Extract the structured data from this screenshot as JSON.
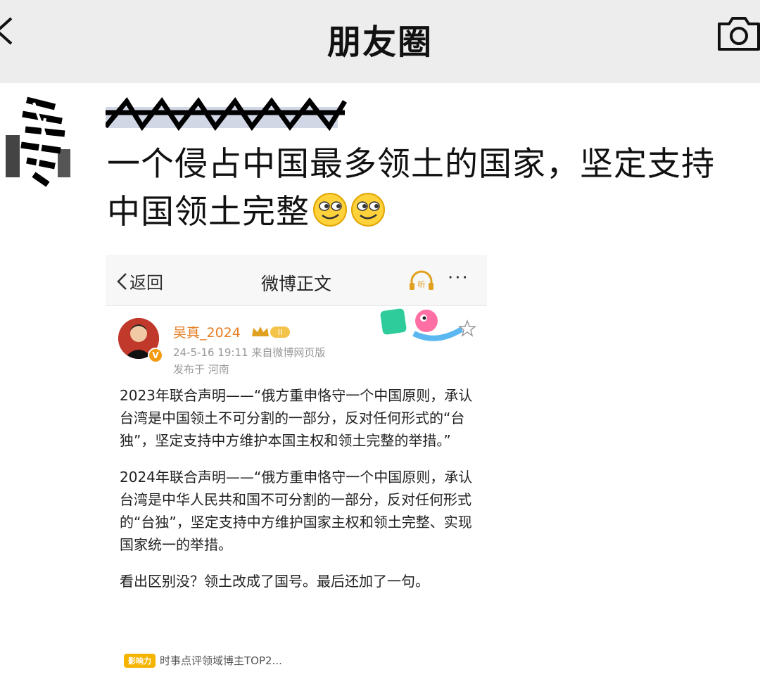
{
  "app": {
    "title": "朋友圈"
  },
  "post": {
    "username": "",
    "text_line1": "一个侵占中国最多领土的国家，坚定支持",
    "text_line2": "中国领土完整",
    "emojis": [
      "smirk-emoji",
      "smirk-emoji"
    ]
  },
  "weibo": {
    "nav_back": "返回",
    "nav_title": "微博正文",
    "listen_label": "听",
    "more_label": "···",
    "author": "吴真_2024",
    "vip_level": "II",
    "timestamp": "24-5-16 19:11",
    "source": "来自微博网页版",
    "location": "发布于 河南",
    "paragraphs": [
      "2023年联合声明——“俄方重申恪守一个中国原则，承认台湾是中国领土不可分割的一部分，反对任何形式的“台独”，坚定支持中方维护本国主权和领土完整的举措。”",
      "2024年联合声明——“俄方重申恪守一个中国原则，承认台湾是中华人民共和国不可分割的一部分，反对任何形式的“台独”，坚定支持中方维护国家主权和领土完整、实现国家统一的举措。",
      "看出区别没？领土改成了国号。最后还加了一句。"
    ],
    "footer_badge": "影响力",
    "footer_text": "时事点评领域博主TOP2..."
  },
  "colors": {
    "topbar_bg": "#ededed",
    "username_link": "#576b95",
    "weibo_author": "#e67e22"
  }
}
